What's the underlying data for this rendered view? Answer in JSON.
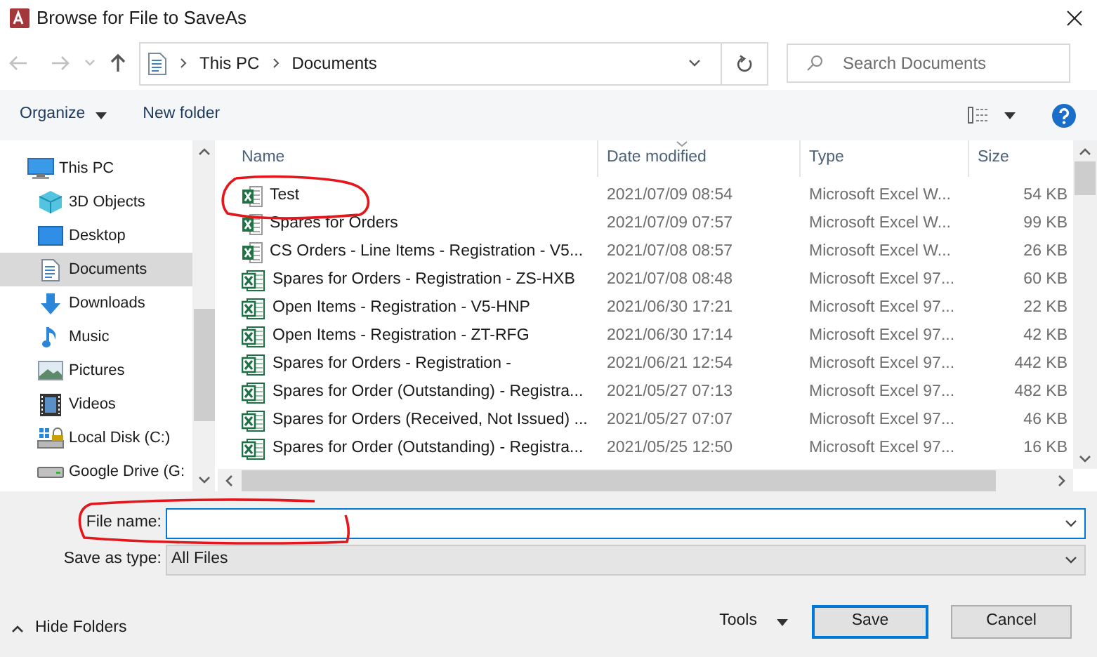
{
  "window": {
    "title": "Browse for File to SaveAs"
  },
  "address": {
    "crumbs": [
      "This PC",
      "Documents"
    ]
  },
  "search": {
    "placeholder": "Search Documents"
  },
  "toolbar": {
    "organize": "Organize",
    "new_folder": "New folder"
  },
  "sidebar": {
    "items": [
      {
        "label": "This PC",
        "kind": "pc",
        "selected": false,
        "children": [
          {
            "label": "3D Objects",
            "kind": "cube",
            "selected": false
          },
          {
            "label": "Desktop",
            "kind": "desktop",
            "selected": false
          },
          {
            "label": "Documents",
            "kind": "documents",
            "selected": true
          },
          {
            "label": "Downloads",
            "kind": "downloads",
            "selected": false
          },
          {
            "label": "Music",
            "kind": "music",
            "selected": false
          },
          {
            "label": "Pictures",
            "kind": "pictures",
            "selected": false
          },
          {
            "label": "Videos",
            "kind": "videos",
            "selected": false
          },
          {
            "label": "Local Disk (C:)",
            "kind": "disk",
            "selected": false
          },
          {
            "label": "Google Drive (G:",
            "kind": "drive",
            "selected": false
          }
        ]
      }
    ]
  },
  "table": {
    "columns": [
      {
        "label": "Name",
        "sorted": false
      },
      {
        "label": "Date modified",
        "sorted": true
      },
      {
        "label": "Type",
        "sorted": false
      },
      {
        "label": "Size",
        "sorted": false
      }
    ],
    "rows": [
      {
        "name": "Test",
        "date": "2021/07/09 08:54",
        "type": "Microsoft Excel W...",
        "size": "54 KB",
        "kind": "xlsx"
      },
      {
        "name": "Spares for Orders",
        "date": "2021/07/09 07:57",
        "type": "Microsoft Excel W...",
        "size": "99 KB",
        "kind": "xlsx"
      },
      {
        "name": "CS Orders - Line Items - Registration - V5...",
        "date": "2021/07/08 08:57",
        "type": "Microsoft Excel W...",
        "size": "26 KB",
        "kind": "xlsx"
      },
      {
        "name": "Spares for Orders - Registration - ZS-HXB",
        "date": "2021/07/08 08:48",
        "type": "Microsoft Excel 97...",
        "size": "60 KB",
        "kind": "xls"
      },
      {
        "name": "Open Items - Registration - V5-HNP",
        "date": "2021/06/30 17:21",
        "type": "Microsoft Excel 97...",
        "size": "22 KB",
        "kind": "xls"
      },
      {
        "name": "Open Items - Registration - ZT-RFG",
        "date": "2021/06/30 17:14",
        "type": "Microsoft Excel 97...",
        "size": "42 KB",
        "kind": "xls"
      },
      {
        "name": "Spares for Orders - Registration -",
        "date": "2021/06/21 12:54",
        "type": "Microsoft Excel 97...",
        "size": "442 KB",
        "kind": "xls"
      },
      {
        "name": "Spares for Order (Outstanding) - Registra...",
        "date": "2021/05/27 07:13",
        "type": "Microsoft Excel 97...",
        "size": "482 KB",
        "kind": "xls"
      },
      {
        "name": "Spares for Orders (Received, Not Issued) ...",
        "date": "2021/05/27 07:07",
        "type": "Microsoft Excel 97...",
        "size": "46 KB",
        "kind": "xls"
      },
      {
        "name": "Spares for Order (Outstanding) - Registra...",
        "date": "2021/05/25 12:50",
        "type": "Microsoft Excel 97...",
        "size": "16 KB",
        "kind": "xls"
      }
    ]
  },
  "file_name": {
    "label": "File name:"
  },
  "save_as_type": {
    "label": "Save as type:",
    "value": "All Files"
  },
  "footer": {
    "hide_folders": "Hide Folders",
    "tools": "Tools",
    "save": "Save",
    "cancel": "Cancel"
  }
}
